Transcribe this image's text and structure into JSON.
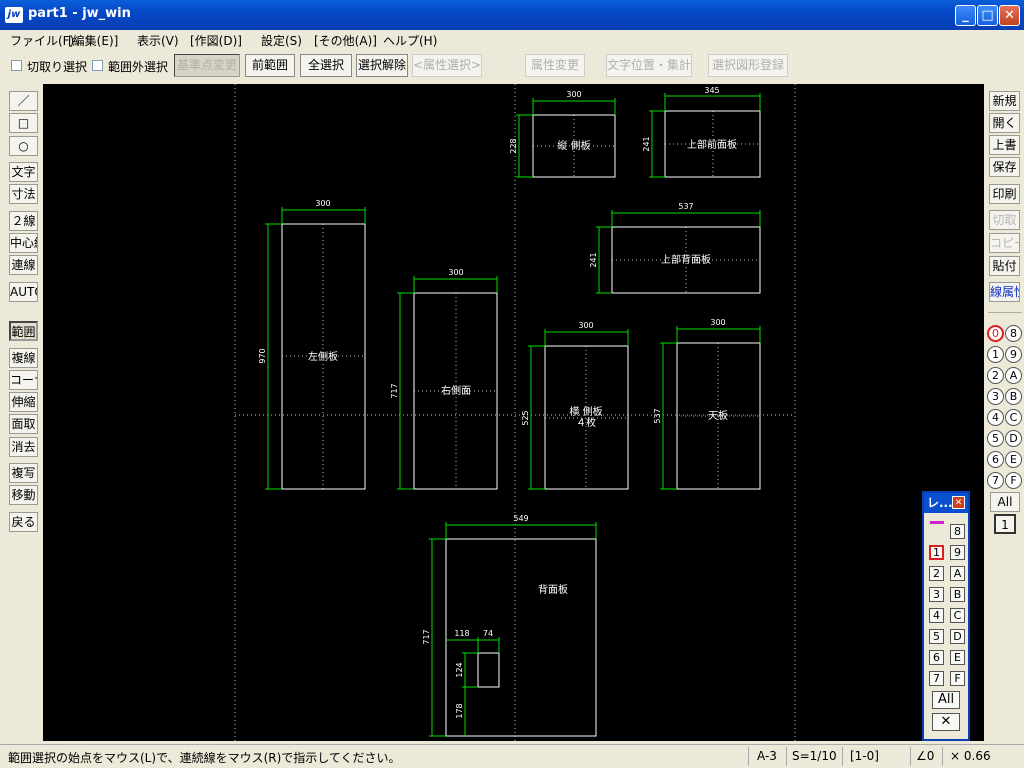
{
  "window": {
    "app_icon_text": "jw",
    "title": "part1 - jw_win"
  },
  "menu": [
    "ファイル(F)",
    "[編集(E)]",
    "表示(V)",
    "[作図(D)]",
    "設定(S)",
    "[その他(A)]",
    "ヘルプ(H)"
  ],
  "toolbar": {
    "cut_select": "切取り選択",
    "outside_select": "範囲外選択",
    "base_point_change": "基準点変更",
    "prev_range": "前範囲",
    "select_all": "全選択",
    "deselect": "選択解除",
    "attr_select": "<属性選択>",
    "attr_change": "属性変更",
    "text_pos_align": "文字位置・集計",
    "register_shape": "選択図形登録"
  },
  "left_tools": [
    "／",
    "□",
    "○",
    "文字",
    "寸法",
    "２線",
    "中心線",
    "連線",
    "AUTO",
    "範囲",
    "複線",
    "コーナー",
    "伸縮",
    "面取",
    "消去",
    "複写",
    "移動",
    "戻る"
  ],
  "right_tools": [
    "新規",
    "開く",
    "上書",
    "保存",
    "印刷",
    "切取",
    "貼付",
    "コピー",
    "線属性"
  ],
  "layers_left": [
    "0",
    "1",
    "2",
    "3",
    "4",
    "5",
    "6",
    "7"
  ],
  "layers_right": [
    "8",
    "9",
    "A",
    "B",
    "C",
    "D",
    "E",
    "F"
  ],
  "layers_all": "All",
  "layer_group_current": "1",
  "palette": {
    "title": "レ...",
    "left": [
      "1",
      "2",
      "3",
      "4",
      "5",
      "6",
      "7"
    ],
    "right": [
      "8",
      "9",
      "A",
      "B",
      "C",
      "D",
      "E",
      "F"
    ],
    "all": "All"
  },
  "status": {
    "message": "範囲選択の始点をマウス(L)で、連続線をマウス(R)で指示してください。",
    "paper": "A-3",
    "scale": "S=1/10",
    "layer": "[1-0]",
    "angle": "∠0",
    "zoom": "× 0.66"
  },
  "drawing": {
    "parts": [
      {
        "label": "縦 側板",
        "width": "300",
        "height": "228"
      },
      {
        "label": "上部前面板",
        "width": "345",
        "height": "241"
      },
      {
        "label": "上部背面板",
        "width": "537",
        "height": "241"
      },
      {
        "label": "左側板",
        "width": "300",
        "height": "970"
      },
      {
        "label": "右側面",
        "width": "300",
        "height": "717"
      },
      {
        "label": "横 側板",
        "label2": "４枚",
        "width": "300",
        "height": "525"
      },
      {
        "label": "天板",
        "width": "300",
        "height": "537"
      },
      {
        "label": "背面板",
        "width": "549",
        "height": "717",
        "sub_w1": "118",
        "sub_w2": "74",
        "sub_h1": "124",
        "sub_h2": "178"
      }
    ]
  },
  "colors": {
    "outline": "#ffffff",
    "dimension": "#00dd00",
    "center_line": "#cccccc",
    "canvas_bg": "#000000"
  }
}
